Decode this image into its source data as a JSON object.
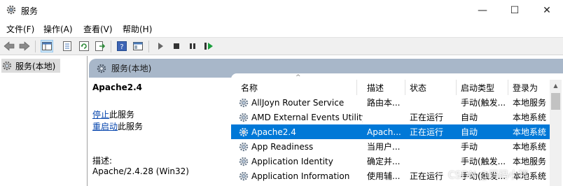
{
  "window": {
    "title": "服务",
    "minimize_glyph": "—",
    "maximize_glyph": "☐",
    "close_glyph": "✕"
  },
  "menu": [
    {
      "label": "文件(F)"
    },
    {
      "label": "操作(A)"
    },
    {
      "label": "查看(V)"
    },
    {
      "label": "帮助(H)"
    }
  ],
  "toolbar": {
    "icons": [
      "back-icon",
      "forward-icon",
      "show-tree-icon",
      "properties-icon",
      "refresh-icon",
      "export-icon",
      "help-icon",
      "console-icon",
      "start-icon",
      "stop-icon",
      "pause-icon",
      "restart-icon"
    ]
  },
  "tree": {
    "items": [
      {
        "label": "服务(本地)"
      }
    ]
  },
  "banner": {
    "label": "服务(本地)"
  },
  "detail": {
    "service_name": "Apache2.4",
    "stop_link": "停止",
    "stop_suffix": "此服务",
    "restart_link": "重启动",
    "restart_suffix": "此服务",
    "description_label": "描述:",
    "description_value": "Apache/2.4.28 (Win32)"
  },
  "list": {
    "sort_indicator": "^",
    "columns": [
      "名称",
      "描述",
      "状态",
      "启动类型",
      "登录为"
    ],
    "rows": [
      {
        "name": "AllJoyn Router Service",
        "desc": "路由本...",
        "status": "",
        "startup": "手动(触发...",
        "logon": "本地服务",
        "selected": false
      },
      {
        "name": "AMD External Events Utility",
        "desc": "",
        "status": "正在运行",
        "startup": "自动",
        "logon": "本地系统",
        "selected": false
      },
      {
        "name": "Apache2.4",
        "desc": "Apach...",
        "status": "正在运行",
        "startup": "自动",
        "logon": "本地系统",
        "selected": true
      },
      {
        "name": "App Readiness",
        "desc": "当用户...",
        "status": "",
        "startup": "手动",
        "logon": "本地系统",
        "selected": false
      },
      {
        "name": "Application Identity",
        "desc": "确定并...",
        "status": "",
        "startup": "手动(触发...",
        "logon": "本地服务",
        "selected": false
      },
      {
        "name": "Application Information",
        "desc": "使用辅...",
        "status": "正在运行",
        "startup": "手动(触发...",
        "logon": "本地系统",
        "selected": false
      }
    ]
  },
  "scrollbar": {
    "up_glyph": "▲"
  },
  "watermark": "CSDN @码码小猪",
  "colors": {
    "selection": "#0078d7",
    "banner": "#a8b7c9",
    "link": "#0645ad"
  }
}
